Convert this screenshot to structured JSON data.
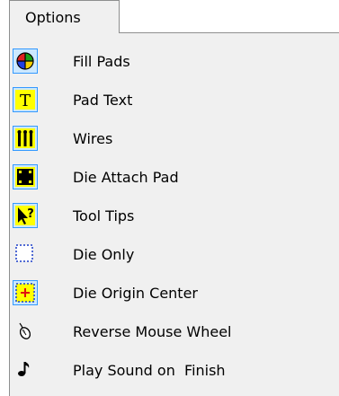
{
  "menu": {
    "title": "Options",
    "items": [
      {
        "label": "Fill Pads",
        "icon": "fill-pads-icon",
        "checked": true
      },
      {
        "label": "Pad Text",
        "icon": "pad-text-icon",
        "checked": true
      },
      {
        "label": "Wires",
        "icon": "wires-icon",
        "checked": true
      },
      {
        "label": "Die Attach Pad",
        "icon": "die-attach-pad-icon",
        "checked": true
      },
      {
        "label": "Tool Tips",
        "icon": "tool-tips-icon",
        "checked": true
      },
      {
        "label": "Die Only",
        "icon": "die-only-icon",
        "checked": false
      },
      {
        "label": "Die Origin Center",
        "icon": "die-origin-center-icon",
        "checked": true
      },
      {
        "label": "Reverse Mouse Wheel",
        "icon": "mouse-icon",
        "checked": false
      },
      {
        "label": "Play Sound on  Finish",
        "icon": "music-note-icon",
        "checked": false
      }
    ]
  }
}
